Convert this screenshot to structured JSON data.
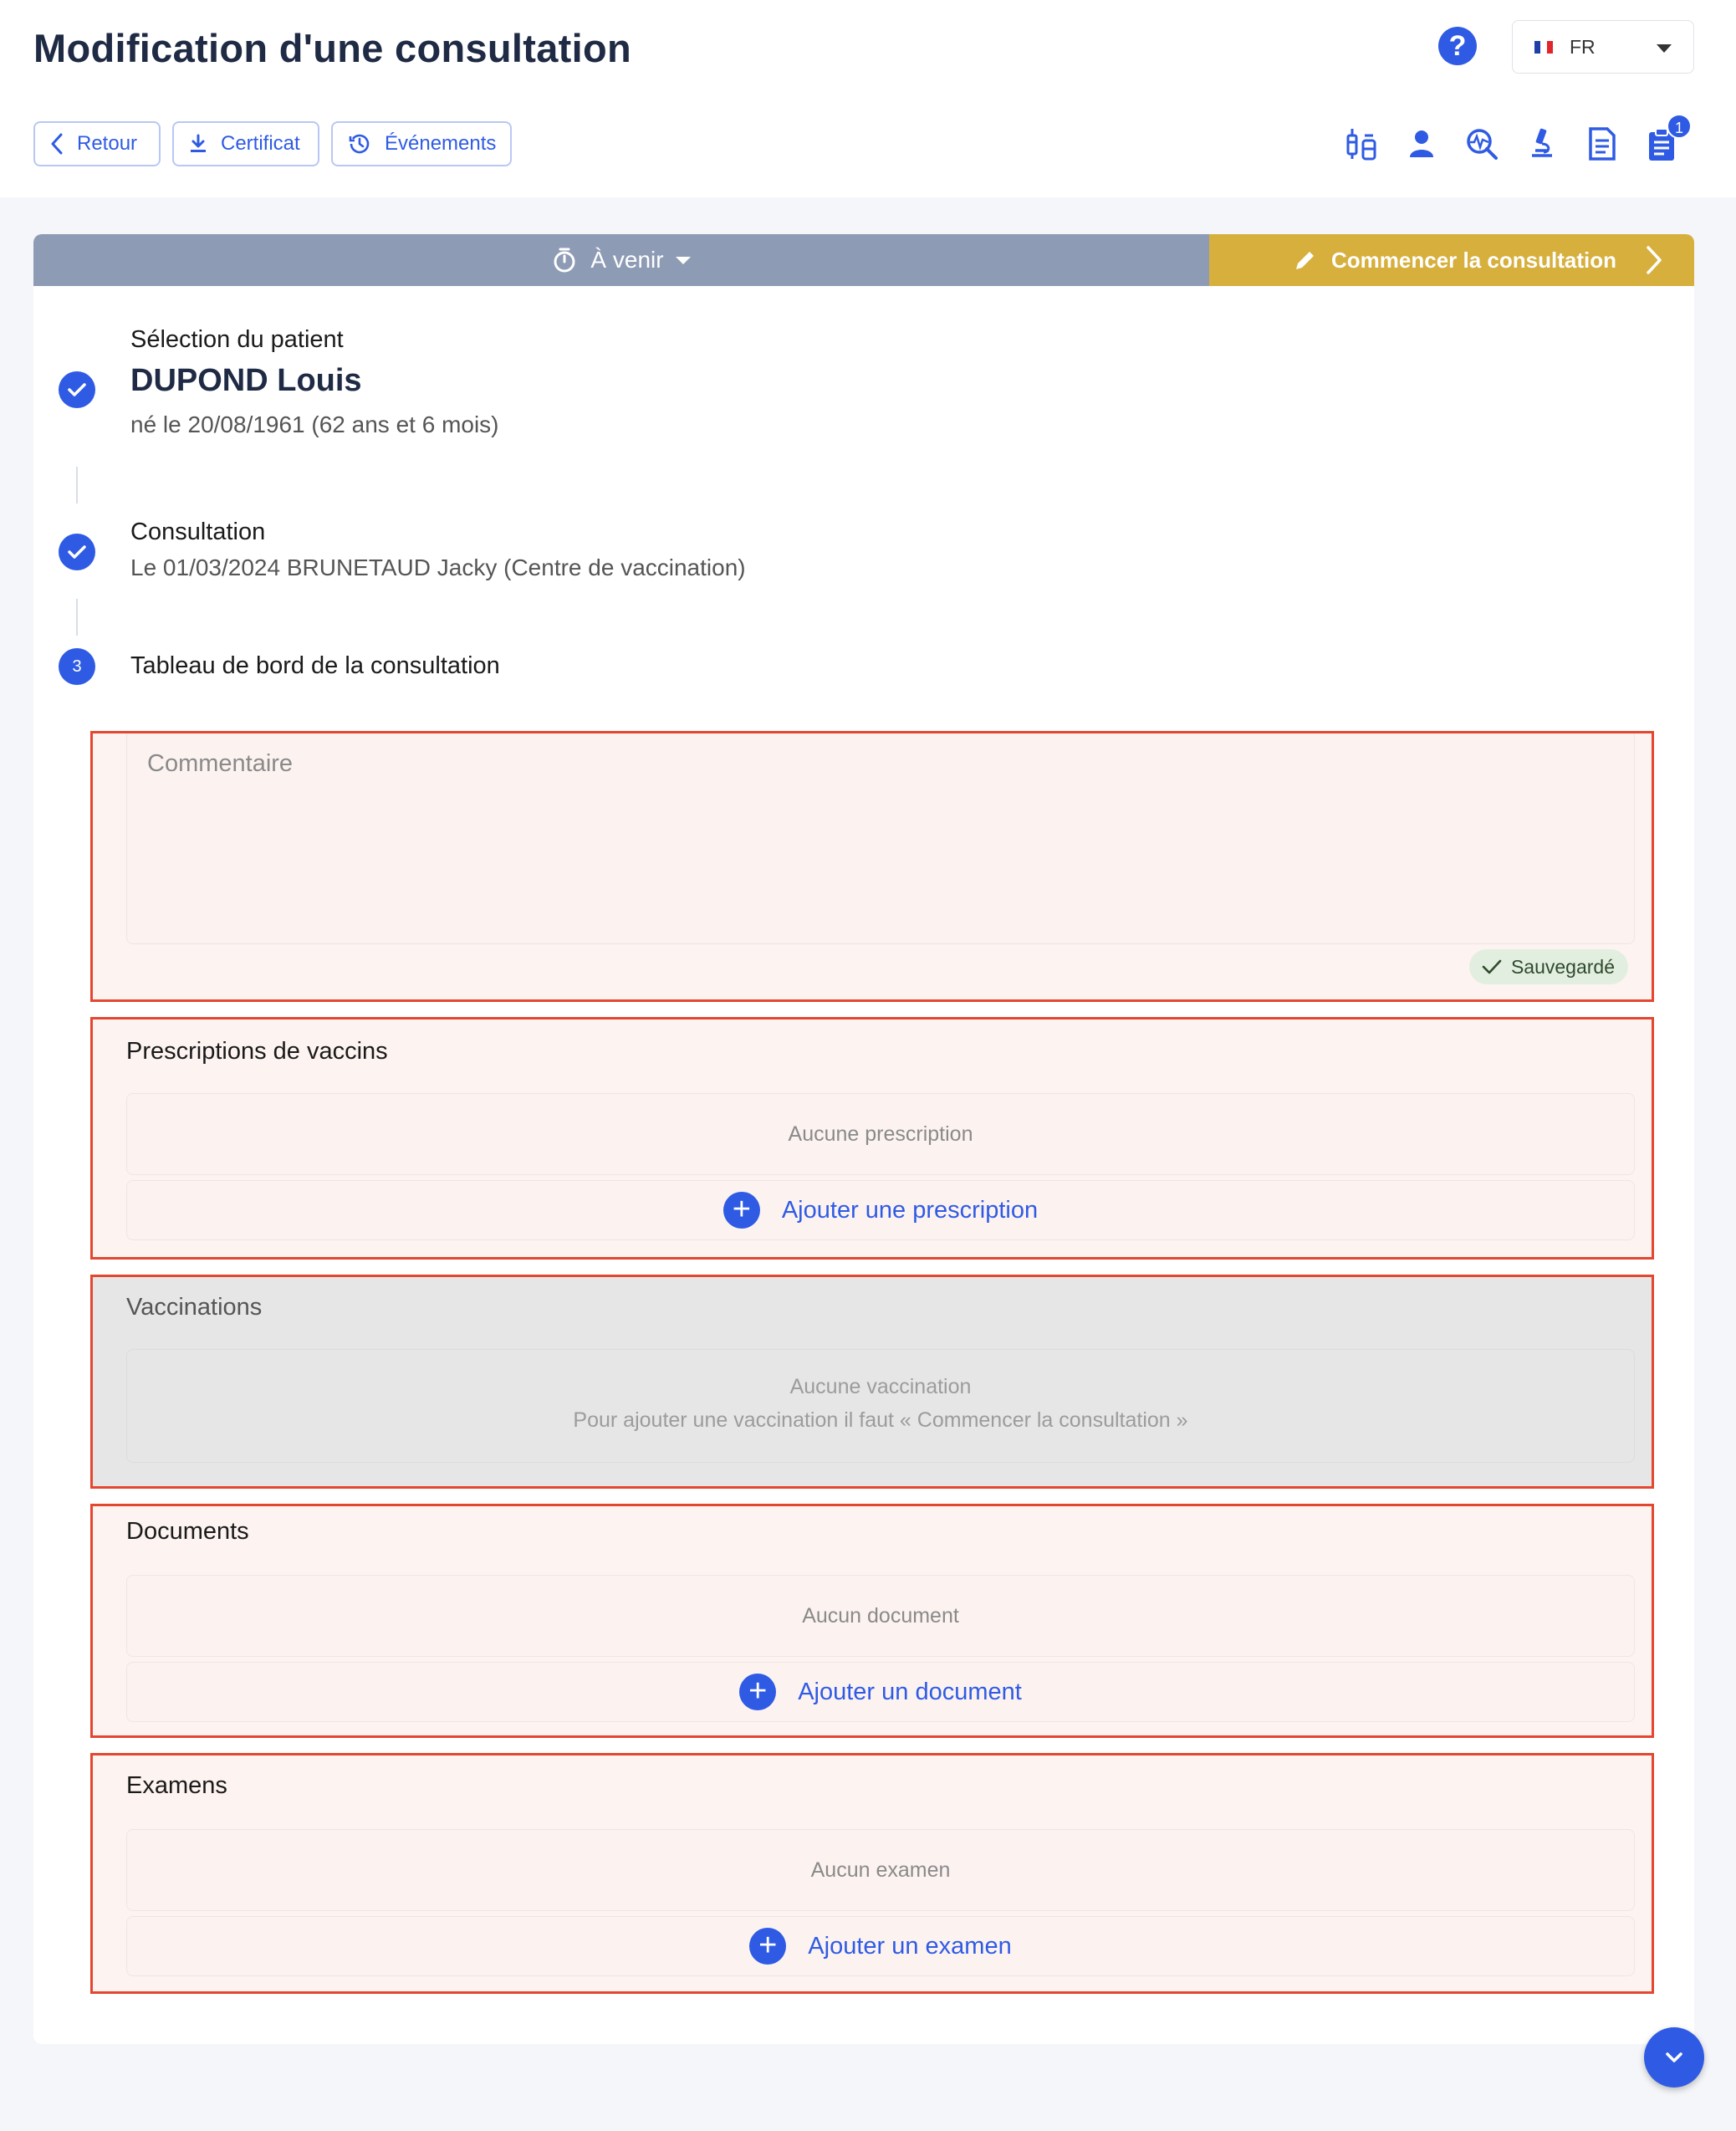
{
  "header": {
    "title": "Modification d'une consultation",
    "help": "?",
    "language": {
      "flag": "fr-flag",
      "code": "FR"
    },
    "buttons": {
      "back": "Retour",
      "certificate": "Certificat",
      "events": "Événements"
    },
    "icons": [
      "vaccine-icon",
      "patient-icon",
      "search-analysis-icon",
      "microscope-icon",
      "document-icon",
      "clipboard-icon"
    ],
    "notification_count": "1"
  },
  "status": {
    "current": "À venir",
    "start_button": "Commencer la consultation"
  },
  "steps": {
    "patient": {
      "label": "Sélection du patient",
      "name": "DUPOND Louis",
      "birth": "né le 20/08/1961 (62 ans et 6 mois)"
    },
    "consultation": {
      "label": "Consultation",
      "detail": "Le 01/03/2024 BRUNETAUD Jacky (Centre de vaccination)"
    },
    "dashboard": {
      "number": "3",
      "label": "Tableau de bord de la consultation"
    }
  },
  "comment": {
    "placeholder": "Commentaire",
    "saved": "Sauvegardé"
  },
  "prescriptions": {
    "title": "Prescriptions de vaccins",
    "empty": "Aucune prescription",
    "add": "Ajouter une prescription"
  },
  "vaccinations": {
    "title": "Vaccinations",
    "empty": "Aucune vaccination",
    "hint": "Pour ajouter une vaccination il faut « Commencer la consultation »"
  },
  "documents": {
    "title": "Documents",
    "empty": "Aucun document",
    "add": "Ajouter un document"
  },
  "exams": {
    "title": "Examens",
    "empty": "Aucun examen",
    "add": "Ajouter un examen"
  },
  "colors": {
    "accent": "#2f5be4",
    "status_bar": "#8e9bb4",
    "start_button": "#d6af3d",
    "highlight_border": "#e3472f"
  }
}
